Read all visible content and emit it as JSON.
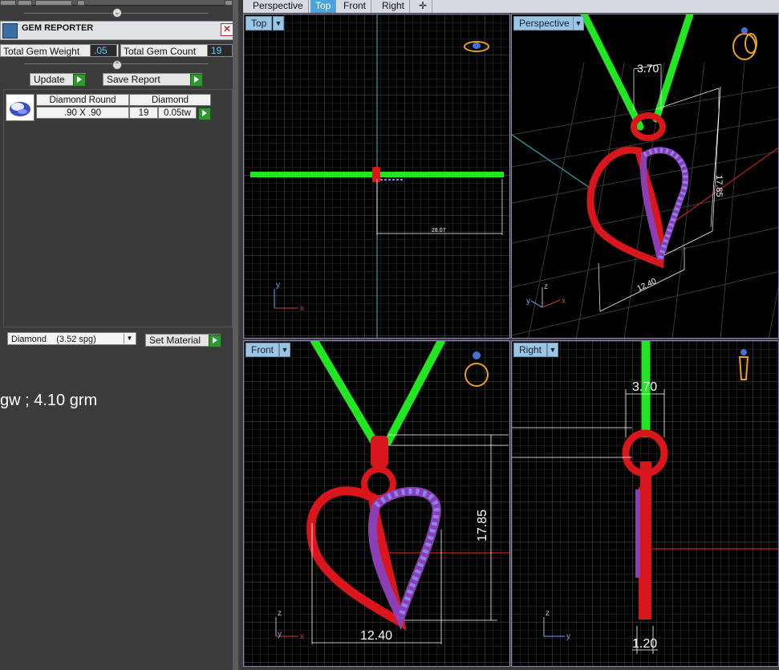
{
  "gem_reporter": {
    "title": "GEM REPORTER",
    "close": "✕",
    "total_weight_label": "Total Gem Weight",
    "total_weight_value": ".05",
    "total_count_label": "Total Gem Count",
    "total_count_value": "19",
    "update_label": "Update",
    "save_report_label": "Save Report",
    "table": {
      "headers": [
        "Diamond Round",
        "Diamond"
      ],
      "row": {
        "size": ".90 X .90",
        "count": "19",
        "weight": "0.05tw"
      }
    },
    "material_select": "Diamond    (3.52 spg)",
    "set_material_label": "Set Material"
  },
  "weight_note": "gw ; 4.10 grm",
  "tabs": [
    "Perspective",
    "Top",
    "Front",
    "Right",
    "✛"
  ],
  "active_tab": "Top",
  "viewports": {
    "top": {
      "label": "Top",
      "dimension": "28.07",
      "axis_x": "x",
      "axis_y": "y"
    },
    "perspective": {
      "label": "Perspective",
      "dim_width": "3.70",
      "dim_height": "17.85",
      "dim_base": "12.40",
      "axis_z": "z",
      "axis_x": "x",
      "axis_y": "y"
    },
    "front": {
      "label": "Front",
      "dim_height": "17.85",
      "dim_width": "12.40",
      "axis_z": "z",
      "axis_x": "x",
      "axis_y": "y"
    },
    "right": {
      "label": "Right",
      "dim_top": "3.70",
      "dim_bottom": "1.20",
      "axis_z": "z",
      "axis_y": "y"
    }
  },
  "colors": {
    "chain": "#22e622",
    "metal": "#d8161c",
    "gems": "#8a84f0",
    "pave_metal": "#8c3fb5",
    "grid": "#4a4a4a",
    "dimension": "#ffffff"
  },
  "icons": [
    "gem-reporter-icon",
    "close-icon",
    "update-arrow-icon",
    "save-arrow-icon",
    "set-material-arrow-icon",
    "diamond-thumbnail-icon",
    "ring-preview-icon",
    "dropdown-arrow-icon"
  ]
}
